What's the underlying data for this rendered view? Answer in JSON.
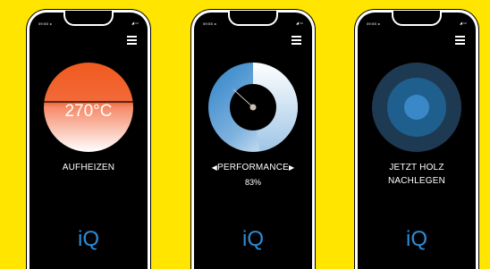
{
  "phones": [
    {
      "status_time": "09:55 ◂",
      "status_right": "◢ ▭",
      "label": "AUFHEIZEN",
      "temperature": "270°C",
      "logo": "iQ",
      "fill_colors": [
        "#F05A1E",
        "#F69778",
        "#FFFFFF"
      ]
    },
    {
      "status_time": "09:55 ◂",
      "status_right": "◢ ▭",
      "label": "PERFORMANCE",
      "prev_icon": "triangle-left-icon",
      "next_icon": "triangle-right-icon",
      "value": "83%",
      "performance_fraction": 0.83,
      "logo": "iQ",
      "ring_colors": [
        "#2D82C8",
        "#FFFFFF"
      ]
    },
    {
      "status_time": "09:55 ◂",
      "status_right": "◢ ▭",
      "label_line1": "JETZT HOLZ",
      "label_line2": "NACHLEGEN",
      "logo": "iQ",
      "target_colors": [
        "#1E3A52",
        "#1F5F8E",
        "#3A88C8"
      ]
    }
  ]
}
